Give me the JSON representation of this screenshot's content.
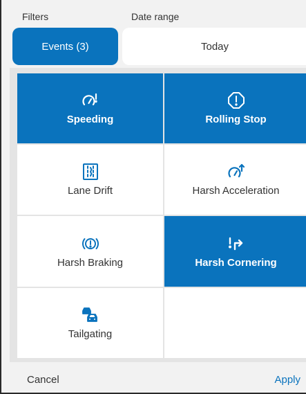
{
  "header": {
    "filters_label": "Filters",
    "date_range_label": "Date range"
  },
  "controls": {
    "events_button": "Events (3)",
    "date_value": "Today"
  },
  "tiles": [
    {
      "label": "Speeding",
      "icon": "speedometer-alert-icon",
      "selected": true
    },
    {
      "label": "Rolling Stop",
      "icon": "stop-sign-icon",
      "selected": true
    },
    {
      "label": "Lane Drift",
      "icon": "lane-drift-icon",
      "selected": false
    },
    {
      "label": "Harsh Acceleration",
      "icon": "speedometer-up-icon",
      "selected": false
    },
    {
      "label": "Harsh Braking",
      "icon": "brake-warning-icon",
      "selected": false
    },
    {
      "label": "Harsh Cornering",
      "icon": "turn-arrow-icon",
      "selected": true
    },
    {
      "label": "Tailgating",
      "icon": "cars-following-icon",
      "selected": false
    },
    {
      "label": "",
      "icon": "",
      "selected": false
    }
  ],
  "footer": {
    "cancel_label": "Cancel",
    "apply_label": "Apply"
  },
  "colors": {
    "accent": "#0a73bd",
    "background": "#f2f2f2",
    "tile_bg": "#ffffff"
  }
}
